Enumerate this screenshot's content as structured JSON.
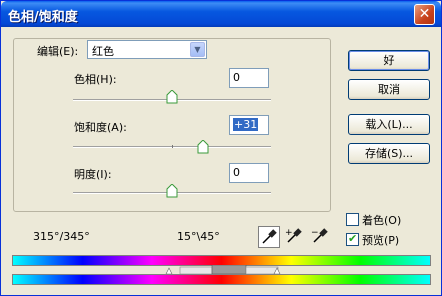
{
  "window": {
    "title": "色相/饱和度",
    "close_glyph": "✕"
  },
  "edit": {
    "label": "编辑(E):",
    "value": "红色"
  },
  "hue": {
    "label": "色相(H):",
    "value": "0",
    "level": 0.5
  },
  "saturation": {
    "label": "饱和度(A):",
    "value": "+31",
    "level": 0.655
  },
  "lightness": {
    "label": "明度(I):",
    "value": "0",
    "level": 0.5
  },
  "buttons": {
    "ok": "好",
    "cancel": "取消",
    "load": "载入(L)...",
    "save": "存储(S)..."
  },
  "options": {
    "colorize": {
      "label": "着色(O)",
      "checked": false
    },
    "preview": {
      "label": "预览(P)",
      "checked": true
    }
  },
  "range": {
    "left": "315°/345°",
    "right": "15°\\45°"
  },
  "tools": [
    "eyedropper-icon",
    "eyedropper-plus-icon",
    "eyedropper-minus-icon"
  ],
  "colors": {
    "title_blue": "#0758e0",
    "face": "#ece9d8",
    "thumb_green": "#3a9a3a"
  }
}
